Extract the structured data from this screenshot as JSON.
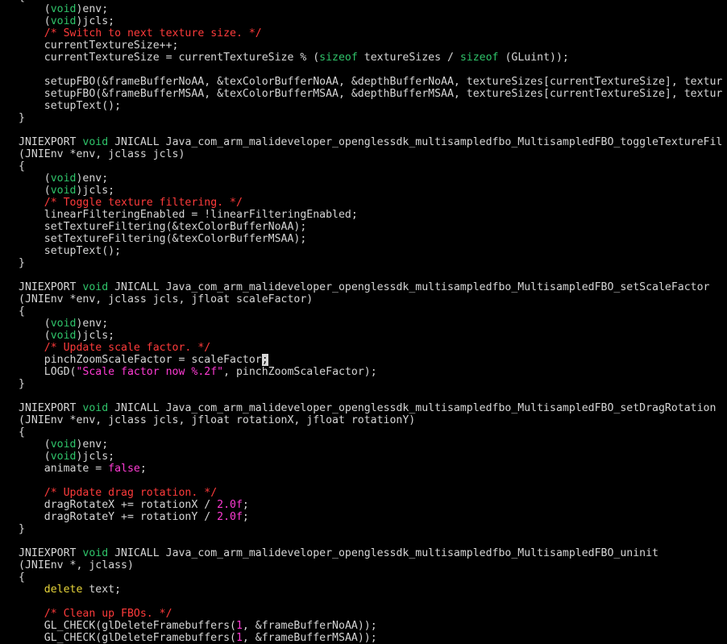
{
  "colors": {
    "background": "#000000",
    "text": "#d6d6d6",
    "keyword": "#2fc46a",
    "comment": "#ff3b3b",
    "literal": "#ff3bd4",
    "statement": "#e6d43a",
    "cursor": "#d6d6d6"
  },
  "lines": [
    [
      [
        "plain",
        "{"
      ]
    ],
    [
      [
        "plain",
        "    ("
      ],
      [
        "keyword",
        "void"
      ],
      [
        "plain",
        ")env;"
      ]
    ],
    [
      [
        "plain",
        "    ("
      ],
      [
        "keyword",
        "void"
      ],
      [
        "plain",
        ")jcls;"
      ]
    ],
    [
      [
        "plain",
        "    "
      ],
      [
        "comment",
        "/* Switch to next texture size. */"
      ]
    ],
    [
      [
        "plain",
        "    currentTextureSize++;"
      ]
    ],
    [
      [
        "plain",
        "    currentTextureSize = currentTextureSize % ("
      ],
      [
        "keyword",
        "sizeof"
      ],
      [
        "plain",
        " textureSizes / "
      ],
      [
        "keyword",
        "sizeof"
      ],
      [
        "plain",
        " (GLuint));"
      ]
    ],
    [
      [
        "plain",
        ""
      ]
    ],
    [
      [
        "plain",
        "    setupFBO(&frameBufferNoAA, &texColorBufferNoAA, &depthBufferNoAA, textureSizes[currentTextureSize], textur"
      ]
    ],
    [
      [
        "plain",
        "    setupFBO(&frameBufferMSAA, &texColorBufferMSAA, &depthBufferMSAA, textureSizes[currentTextureSize], textur"
      ]
    ],
    [
      [
        "plain",
        "    setupText();"
      ]
    ],
    [
      [
        "plain",
        "}"
      ]
    ],
    [
      [
        "plain",
        ""
      ]
    ],
    [
      [
        "plain",
        "JNIEXPORT "
      ],
      [
        "keyword",
        "void"
      ],
      [
        "plain",
        " JNICALL Java_com_arm_malideveloper_openglessdk_multisampledfbo_MultisampledFBO_toggleTextureFil"
      ]
    ],
    [
      [
        "plain",
        "(JNIEnv *env, jclass jcls)"
      ]
    ],
    [
      [
        "plain",
        "{"
      ]
    ],
    [
      [
        "plain",
        "    ("
      ],
      [
        "keyword",
        "void"
      ],
      [
        "plain",
        ")env;"
      ]
    ],
    [
      [
        "plain",
        "    ("
      ],
      [
        "keyword",
        "void"
      ],
      [
        "plain",
        ")jcls;"
      ]
    ],
    [
      [
        "plain",
        "    "
      ],
      [
        "comment",
        "/* Toggle texture filtering. */"
      ]
    ],
    [
      [
        "plain",
        "    linearFilteringEnabled = !linearFilteringEnabled;"
      ]
    ],
    [
      [
        "plain",
        "    setTextureFiltering(&texColorBufferNoAA);"
      ]
    ],
    [
      [
        "plain",
        "    setTextureFiltering(&texColorBufferMSAA);"
      ]
    ],
    [
      [
        "plain",
        "    setupText();"
      ]
    ],
    [
      [
        "plain",
        "}"
      ]
    ],
    [
      [
        "plain",
        ""
      ]
    ],
    [
      [
        "plain",
        "JNIEXPORT "
      ],
      [
        "keyword",
        "void"
      ],
      [
        "plain",
        " JNICALL Java_com_arm_malideveloper_openglessdk_multisampledfbo_MultisampledFBO_setScaleFactor"
      ]
    ],
    [
      [
        "plain",
        "(JNIEnv *env, jclass jcls, jfloat scaleFactor)"
      ]
    ],
    [
      [
        "plain",
        "{"
      ]
    ],
    [
      [
        "plain",
        "    ("
      ],
      [
        "keyword",
        "void"
      ],
      [
        "plain",
        ")env;"
      ]
    ],
    [
      [
        "plain",
        "    ("
      ],
      [
        "keyword",
        "void"
      ],
      [
        "plain",
        ")jcls;"
      ]
    ],
    [
      [
        "plain",
        "    "
      ],
      [
        "comment",
        "/* Update scale factor. */"
      ]
    ],
    [
      [
        "plain",
        "    pinchZoomScaleFactor = scaleFactor"
      ],
      [
        "cursor",
        ";"
      ]
    ],
    [
      [
        "plain",
        "    LOGD("
      ],
      [
        "string",
        "\"Scale factor now %.2f\""
      ],
      [
        "plain",
        ", pinchZoomScaleFactor);"
      ]
    ],
    [
      [
        "plain",
        "}"
      ]
    ],
    [
      [
        "plain",
        ""
      ]
    ],
    [
      [
        "plain",
        "JNIEXPORT "
      ],
      [
        "keyword",
        "void"
      ],
      [
        "plain",
        " JNICALL Java_com_arm_malideveloper_openglessdk_multisampledfbo_MultisampledFBO_setDragRotation"
      ]
    ],
    [
      [
        "plain",
        "(JNIEnv *env, jclass jcls, jfloat rotationX, jfloat rotationY)"
      ]
    ],
    [
      [
        "plain",
        "{"
      ]
    ],
    [
      [
        "plain",
        "    ("
      ],
      [
        "keyword",
        "void"
      ],
      [
        "plain",
        ")env;"
      ]
    ],
    [
      [
        "plain",
        "    ("
      ],
      [
        "keyword",
        "void"
      ],
      [
        "plain",
        ")jcls;"
      ]
    ],
    [
      [
        "plain",
        "    animate = "
      ],
      [
        "constant",
        "false"
      ],
      [
        "plain",
        ";"
      ]
    ],
    [
      [
        "plain",
        ""
      ]
    ],
    [
      [
        "plain",
        "    "
      ],
      [
        "comment",
        "/* Update drag rotation. */"
      ]
    ],
    [
      [
        "plain",
        "    dragRotateX += rotationX / "
      ],
      [
        "number",
        "2.0f"
      ],
      [
        "plain",
        ";"
      ]
    ],
    [
      [
        "plain",
        "    dragRotateY += rotationY / "
      ],
      [
        "number",
        "2.0f"
      ],
      [
        "plain",
        ";"
      ]
    ],
    [
      [
        "plain",
        "}"
      ]
    ],
    [
      [
        "plain",
        ""
      ]
    ],
    [
      [
        "plain",
        "JNIEXPORT "
      ],
      [
        "keyword",
        "void"
      ],
      [
        "plain",
        " JNICALL Java_com_arm_malideveloper_openglessdk_multisampledfbo_MultisampledFBO_uninit"
      ]
    ],
    [
      [
        "plain",
        "(JNIEnv *, jclass)"
      ]
    ],
    [
      [
        "plain",
        "{"
      ]
    ],
    [
      [
        "plain",
        "    "
      ],
      [
        "statement",
        "delete"
      ],
      [
        "plain",
        " text;"
      ]
    ],
    [
      [
        "plain",
        ""
      ]
    ],
    [
      [
        "plain",
        "    "
      ],
      [
        "comment",
        "/* Clean up FBOs. */"
      ]
    ],
    [
      [
        "plain",
        "    GL_CHECK(glDeleteFramebuffers("
      ],
      [
        "number",
        "1"
      ],
      [
        "plain",
        ", &frameBufferNoAA));"
      ]
    ],
    [
      [
        "plain",
        "    GL_CHECK(glDeleteFramebuffers("
      ],
      [
        "number",
        "1"
      ],
      [
        "plain",
        ", &frameBufferMSAA));"
      ]
    ]
  ]
}
